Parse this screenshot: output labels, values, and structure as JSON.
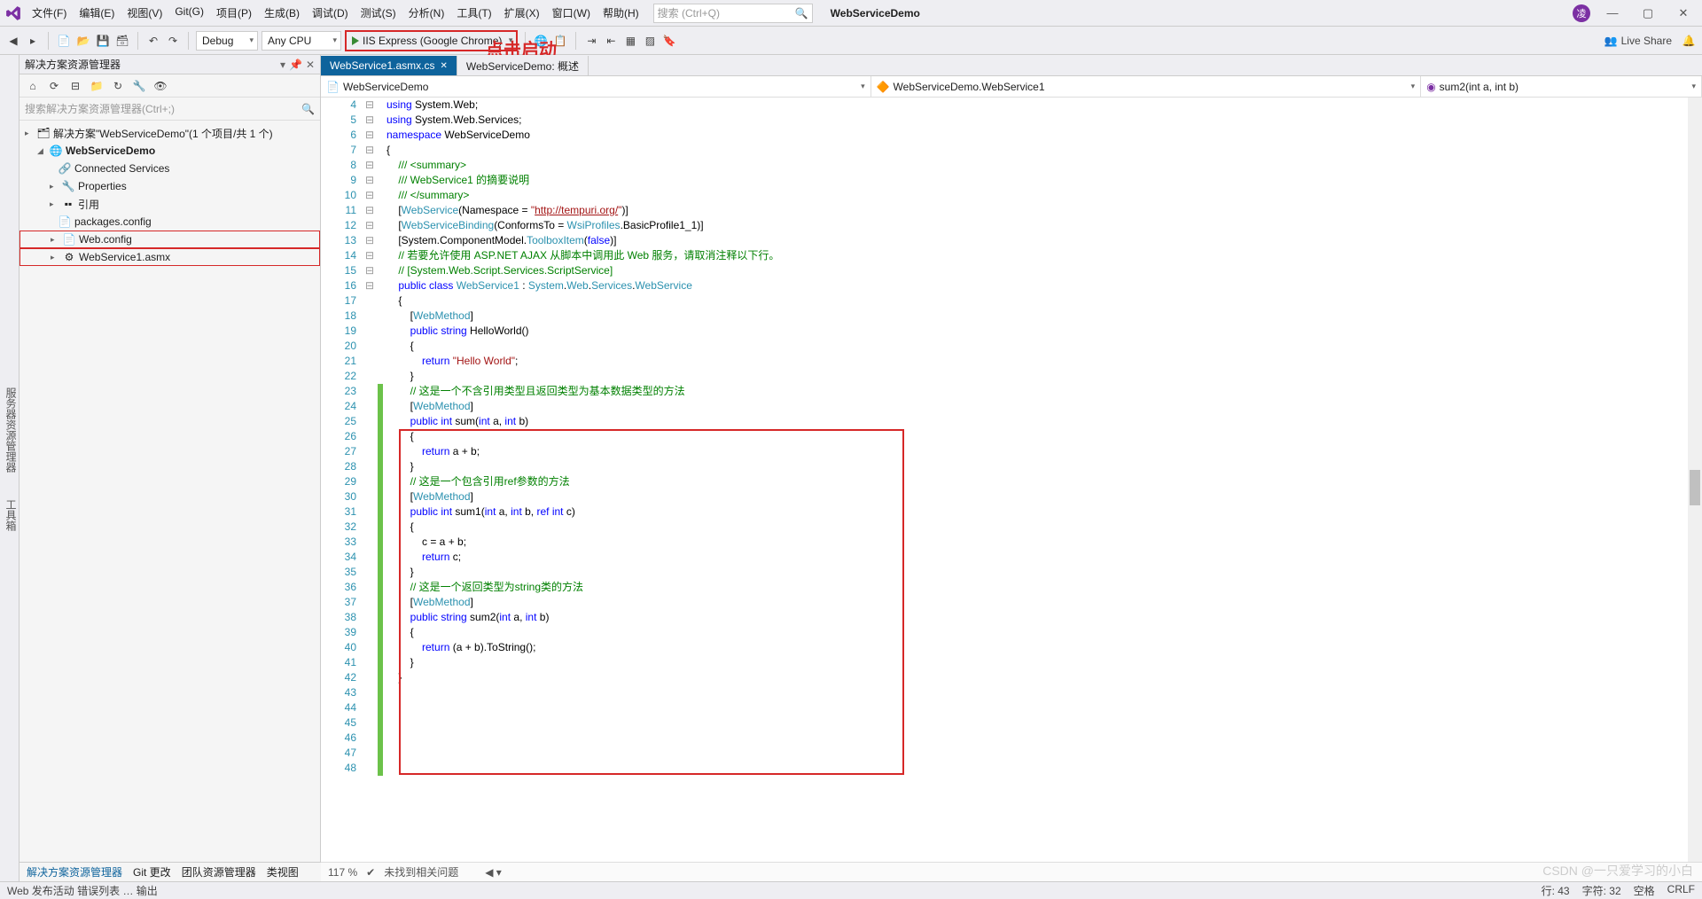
{
  "title": {
    "project": "WebServiceDemo"
  },
  "menu": [
    "文件(F)",
    "编辑(E)",
    "视图(V)",
    "Git(G)",
    "项目(P)",
    "生成(B)",
    "调试(D)",
    "测试(S)",
    "分析(N)",
    "工具(T)",
    "扩展(X)",
    "窗口(W)",
    "帮助(H)"
  ],
  "search_placeholder": "搜索 (Ctrl+Q)",
  "avatar": "凌",
  "toolbar": {
    "config": "Debug",
    "platform": "Any CPU",
    "run": "IIS Express (Google Chrome)",
    "liveshare": "Live Share"
  },
  "annotation": "点击启动",
  "left_strip": [
    "服务器资源管理器",
    "工具箱"
  ],
  "solution_panel": {
    "title": "解决方案资源管理器",
    "search_placeholder": "搜索解决方案资源管理器(Ctrl+;)",
    "solution": "解决方案\"WebServiceDemo\"(1 个项目/共 1 个)",
    "project": "WebServiceDemo",
    "items": [
      "Connected Services",
      "Properties",
      "引用",
      "packages.config",
      "Web.config",
      "WebService1.asmx"
    ]
  },
  "tabs": {
    "active": "WebService1.asmx.cs",
    "inactive": "WebServiceDemo: 概述"
  },
  "navbar": {
    "scope": "WebServiceDemo",
    "class": "WebServiceDemo.WebService1",
    "member": "sum2(int a, int b)"
  },
  "code_lines": [
    {
      "n": 4,
      "h": "<span class='kw'>using</span> System.Web;"
    },
    {
      "n": 5,
      "h": "<span class='kw'>using</span> System.Web.Services;"
    },
    {
      "n": 6,
      "h": ""
    },
    {
      "n": 7,
      "h": "<span class='kw'>namespace</span> WebServiceDemo"
    },
    {
      "n": 8,
      "h": "{"
    },
    {
      "n": 9,
      "h": "    <span class='com'>/// &lt;summary&gt;</span>"
    },
    {
      "n": 10,
      "h": "    <span class='com'>/// WebService1 的摘要说明</span>"
    },
    {
      "n": 11,
      "h": "    <span class='com'>/// &lt;/summary&gt;</span>"
    },
    {
      "n": 12,
      "h": "    [<span class='type'>WebService</span>(Namespace = <span class='str'>\"<span class='url'>http://tempuri.org/</span>\"</span>)]"
    },
    {
      "n": 13,
      "h": "    [<span class='type'>WebServiceBinding</span>(ConformsTo = <span class='type'>WsiProfiles</span>.BasicProfile1_1)]"
    },
    {
      "n": 14,
      "h": "    [System.ComponentModel.<span class='type'>ToolboxItem</span>(<span class='kw'>false</span>)]"
    },
    {
      "n": 15,
      "h": "    <span class='com'>// 若要允许使用 ASP.NET AJAX 从脚本中调用此 Web 服务，请取消注释以下行。</span>"
    },
    {
      "n": 16,
      "h": "    <span class='com'>// [System.Web.Script.Services.ScriptService]</span>"
    },
    {
      "n": 17,
      "h": "    <span class='kw'>public class</span> <span class='type'>WebService1</span> : <span class='type'>System</span>.<span class='type'>Web</span>.<span class='type'>Services</span>.<span class='type'>WebService</span>"
    },
    {
      "n": 18,
      "h": "    {"
    },
    {
      "n": 19,
      "h": ""
    },
    {
      "n": 20,
      "h": "        [<span class='type'>WebMethod</span>]"
    },
    {
      "n": 21,
      "h": "        <span class='kw'>public string</span> HelloWorld()"
    },
    {
      "n": 22,
      "h": "        {"
    },
    {
      "n": 23,
      "h": "            <span class='kw'>return</span> <span class='str'>\"Hello World\"</span>;"
    },
    {
      "n": 24,
      "h": "        }"
    },
    {
      "n": 25,
      "h": ""
    },
    {
      "n": 26,
      "h": "        <span class='com'>// 这是一个不含引用类型且返回类型为基本数据类型的方法</span>"
    },
    {
      "n": 27,
      "h": "        [<span class='type'>WebMethod</span>]"
    },
    {
      "n": 28,
      "h": "        <span class='kw'>public int</span> sum(<span class='kw'>int</span> a, <span class='kw'>int</span> b)"
    },
    {
      "n": 29,
      "h": "        {"
    },
    {
      "n": 30,
      "h": "            <span class='kw'>return</span> a + b;"
    },
    {
      "n": 31,
      "h": "        }"
    },
    {
      "n": 32,
      "h": ""
    },
    {
      "n": 33,
      "h": "        <span class='com'>// 这是一个包含引用ref参数的方法</span>"
    },
    {
      "n": 34,
      "h": "        [<span class='type'>WebMethod</span>]"
    },
    {
      "n": 35,
      "h": "        <span class='kw'>public int</span> sum1(<span class='kw'>int</span> a, <span class='kw'>int</span> b, <span class='kw'>ref int</span> c)"
    },
    {
      "n": 36,
      "h": "        {"
    },
    {
      "n": 37,
      "h": "            c = a + b;"
    },
    {
      "n": 38,
      "h": "            <span class='kw'>return</span> c;"
    },
    {
      "n": 39,
      "h": "        }"
    },
    {
      "n": 40,
      "h": ""
    },
    {
      "n": 41,
      "h": "        <span class='com'>// 这是一个返回类型为string类的方法</span>"
    },
    {
      "n": 42,
      "h": "        [<span class='type'>WebMethod</span>]"
    },
    {
      "n": 43,
      "h": "        <span class='kw'>public string</span> sum2(<span class='kw'>int</span> a, <span class='kw'>int</span> b)"
    },
    {
      "n": 44,
      "h": "        {"
    },
    {
      "n": 45,
      "h": "            <span class='kw'>return</span> (a + b).ToString();"
    },
    {
      "n": 46,
      "h": "        }"
    },
    {
      "n": 47,
      "h": "    }"
    },
    {
      "n": 48,
      "h": ""
    }
  ],
  "editor_status": {
    "zoom": "117 %",
    "issues": "未找到相关问题"
  },
  "bottom_tabs": [
    "解决方案资源管理器",
    "Git 更改",
    "团队资源管理器",
    "类视图"
  ],
  "statusbar": {
    "left": [
      "Web 发布活动",
      "错误列表 …",
      "输出"
    ],
    "line": "行: 43",
    "col": "字符: 32",
    "spaces": "空格",
    "crlf": "CRLF"
  },
  "watermark": "CSDN @一只爱学习的小白"
}
